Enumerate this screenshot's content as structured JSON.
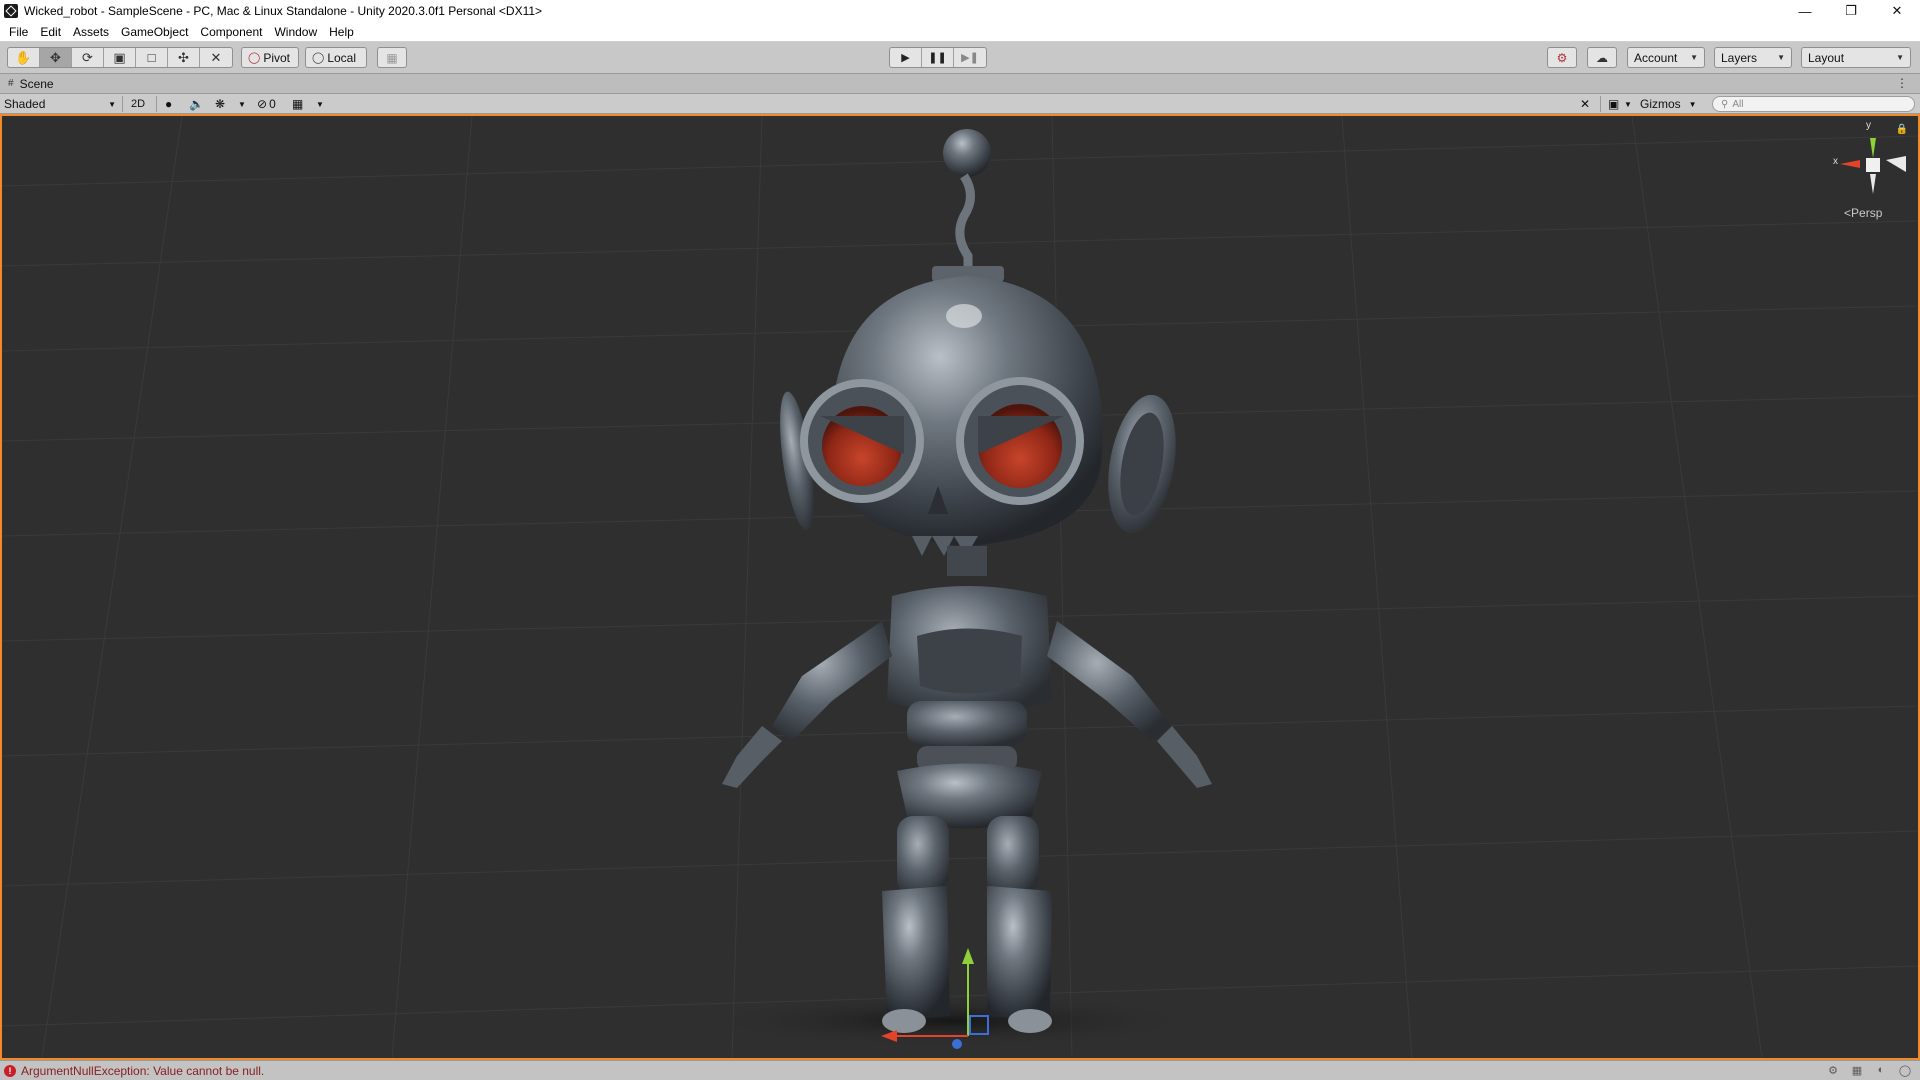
{
  "window": {
    "title": "Wicked_robot - SampleScene - PC, Mac & Linux Standalone - Unity 2020.3.0f1 Personal <DX11>",
    "controls": [
      "minimize-icon",
      "restore-icon",
      "close-icon"
    ]
  },
  "menu": {
    "items": [
      "File",
      "Edit",
      "Assets",
      "GameObject",
      "Component",
      "Window",
      "Help"
    ]
  },
  "toolbar": {
    "tools": [
      "hand-tool-icon",
      "move-tool-icon",
      "rotate-tool-icon",
      "scale-tool-icon",
      "rect-tool-icon",
      "transform-tool-icon",
      "custom-tool-icon"
    ],
    "pivot_label": "Pivot",
    "local_label": "Local",
    "account_label": "Account",
    "layers_label": "Layers",
    "layout_label": "Layout"
  },
  "scene": {
    "tab_label": "Scene",
    "shading_mode": "Shaded",
    "mode_2d_label": "2D",
    "hidden_count": "0",
    "gizmos_label": "Gizmos",
    "search_placeholder": "All",
    "projection_label": "Persp",
    "axis_x": "x",
    "axis_y": "y"
  },
  "status": {
    "error_message": "ArgumentNullException: Value cannot be null."
  },
  "colors": {
    "viewport_bg": "#2f2f2f",
    "viewport_border": "#f08a2a",
    "error": "#c8202a",
    "axis_x": "#e2432a",
    "axis_y": "#8ed13a",
    "axis_z": "#3b6fd6"
  }
}
